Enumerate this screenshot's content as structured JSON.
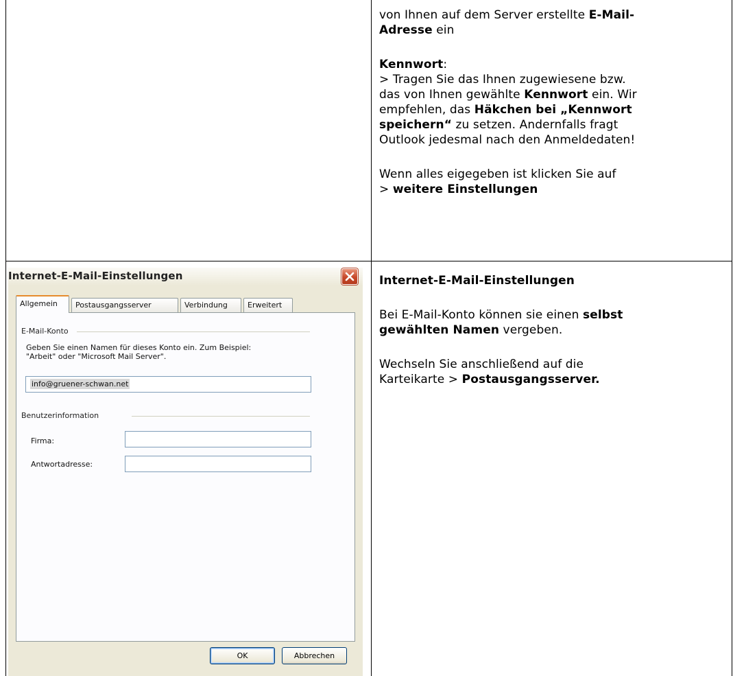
{
  "doc": {
    "row1": {
      "line1_a": "von Ihnen auf dem Server erstellte ",
      "line1_b": "E-Mail-",
      "line2_a": "Adresse",
      "line2_b": " ein",
      "kennwort_heading": "Kennwort",
      "colon": ":",
      "p1": "> Tragen Sie das Ihnen zugewiesene bzw.",
      "p2_a": "das von Ihnen gewählte ",
      "p2_b": "Kennwort",
      "p2_c": " ein. Wir",
      "p3_a": "empfehlen, das ",
      "p3_b": "Häkchen bei „Kennwort",
      "p4_a": "speichern“",
      "p4_b": " zu setzen. Andernfalls fragt",
      "p5": "Outlook jedesmal nach den Anmeldedaten!",
      "p6": "Wenn alles eigegeben ist klicken Sie auf",
      "p7_a": "> ",
      "p7_b": "weitere Einstellungen"
    },
    "row2": {
      "heading": "Internet-E-Mail-Einstellungen",
      "p1_a": "Bei E-Mail-Konto können sie einen ",
      "p1_b": "selbst",
      "p2_a": "gewählten Namen",
      "p2_b": " vergeben.",
      "p3": "Wechseln Sie anschließend auf die",
      "p4_a": "Karteikarte > ",
      "p4_b": "Postausgangsserver."
    }
  },
  "dialog": {
    "title": "Internet-E-Mail-Einstellungen",
    "tabs": [
      "Allgemein",
      "Postausgangsserver",
      "Verbindung",
      "Erweitert"
    ],
    "active_tab": "Allgemein",
    "group_account": "E-Mail-Konto",
    "account_desc_1": "Geben Sie einen Namen für dieses Konto ein. Zum Beispiel:",
    "account_desc_2": "\"Arbeit\" oder \"Microsoft Mail Server\".",
    "account_value": "info@gruener-schwan.net",
    "group_user": "Benutzerinformation",
    "firma_label": "Firma:",
    "firma_value": "",
    "reply_label": "Antwortadresse:",
    "reply_value": "",
    "ok_label": "OK",
    "cancel_label": "Abbrechen"
  },
  "colors": {
    "xp_face": "#ece9d8",
    "tab_highlight": "#e68b2c",
    "close_red": "#c7482a"
  }
}
